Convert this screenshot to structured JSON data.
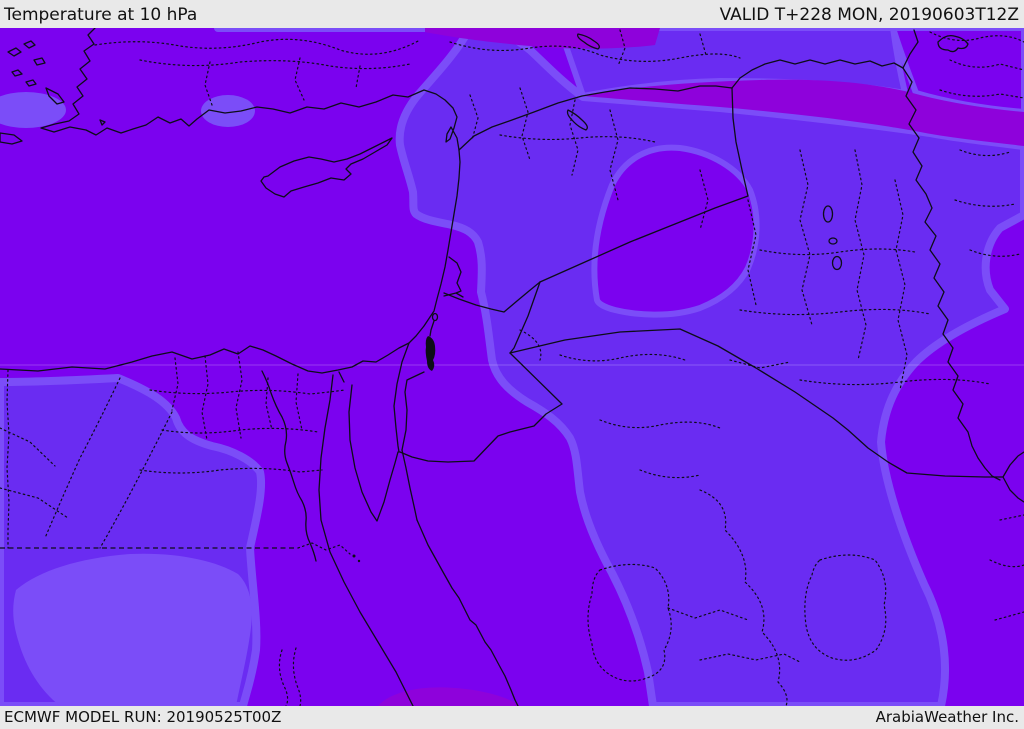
{
  "header": {
    "title": "Temperature at 10 hPa",
    "valid": "VALID T+228 MON, 20190603T12Z"
  },
  "footer": {
    "model_run": "ECMWF MODEL RUN: 20190525T00Z",
    "credit": "ArabiaWeather Inc."
  },
  "palette": {
    "violet": "#7B02EF",
    "blue": "#6A2CF2",
    "light": "#7B4DF8",
    "magenta": "#8E02DB",
    "line": "#0D0D18",
    "chrome": "#E9E9E9",
    "chrome_text": "#111111"
  }
}
